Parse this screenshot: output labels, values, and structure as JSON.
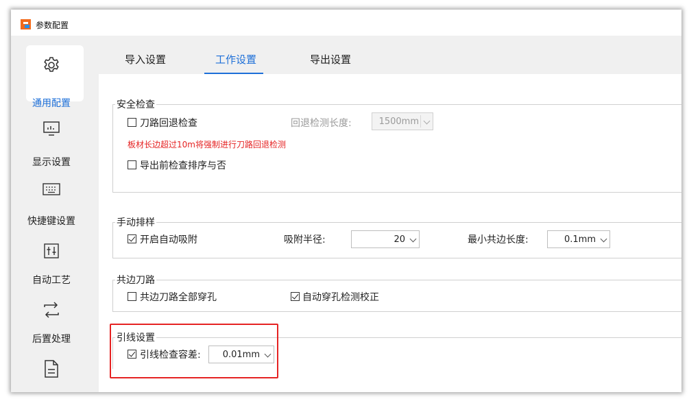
{
  "window": {
    "title": "参数配置"
  },
  "sidebar": {
    "items": [
      {
        "label": "通用配置",
        "icon": "gear-icon",
        "active": true
      },
      {
        "label": "显示设置",
        "icon": "monitor-icon"
      },
      {
        "label": "快捷键设置",
        "icon": "keyboard-icon"
      },
      {
        "label": "自动工艺",
        "icon": "sliders-icon"
      },
      {
        "label": "后置处理",
        "icon": "swap-arrows-icon"
      },
      {
        "label": "",
        "icon": "document-icon"
      }
    ]
  },
  "tabs": [
    {
      "label": "导入设置"
    },
    {
      "label": "工作设置",
      "active": true
    },
    {
      "label": "导出设置"
    }
  ],
  "safety": {
    "title": "安全检查",
    "retract_label": "刀路回退检查",
    "retract_checked": false,
    "retract_length_label": "回退检测长度:",
    "retract_length_value": "1500mm",
    "warning": "板材长边超过10m将强制进行刀路回退检测",
    "sort_check_label": "导出前检查排序与否",
    "sort_check_checked": false
  },
  "manual_nest": {
    "title": "手动排样",
    "auto_snap_label": "开启自动吸附",
    "auto_snap_checked": true,
    "snap_radius_label": "吸附半径:",
    "snap_radius_value": "20",
    "min_common_label": "最小共边长度:",
    "min_common_value": "0.1mm"
  },
  "common_edge": {
    "title": "共边刀路",
    "all_pierce_label": "共边刀路全部穿孔",
    "all_pierce_checked": false,
    "auto_pierce_label": "自动穿孔检测校正",
    "auto_pierce_checked": true
  },
  "leadin": {
    "title": "引线设置",
    "tolerance_label": "引线检查容差:",
    "tolerance_checked": true,
    "tolerance_value": "0.01mm"
  },
  "colors": {
    "accent": "#1d6fd8",
    "warning": "#e52222",
    "highlight": "#e52222"
  }
}
